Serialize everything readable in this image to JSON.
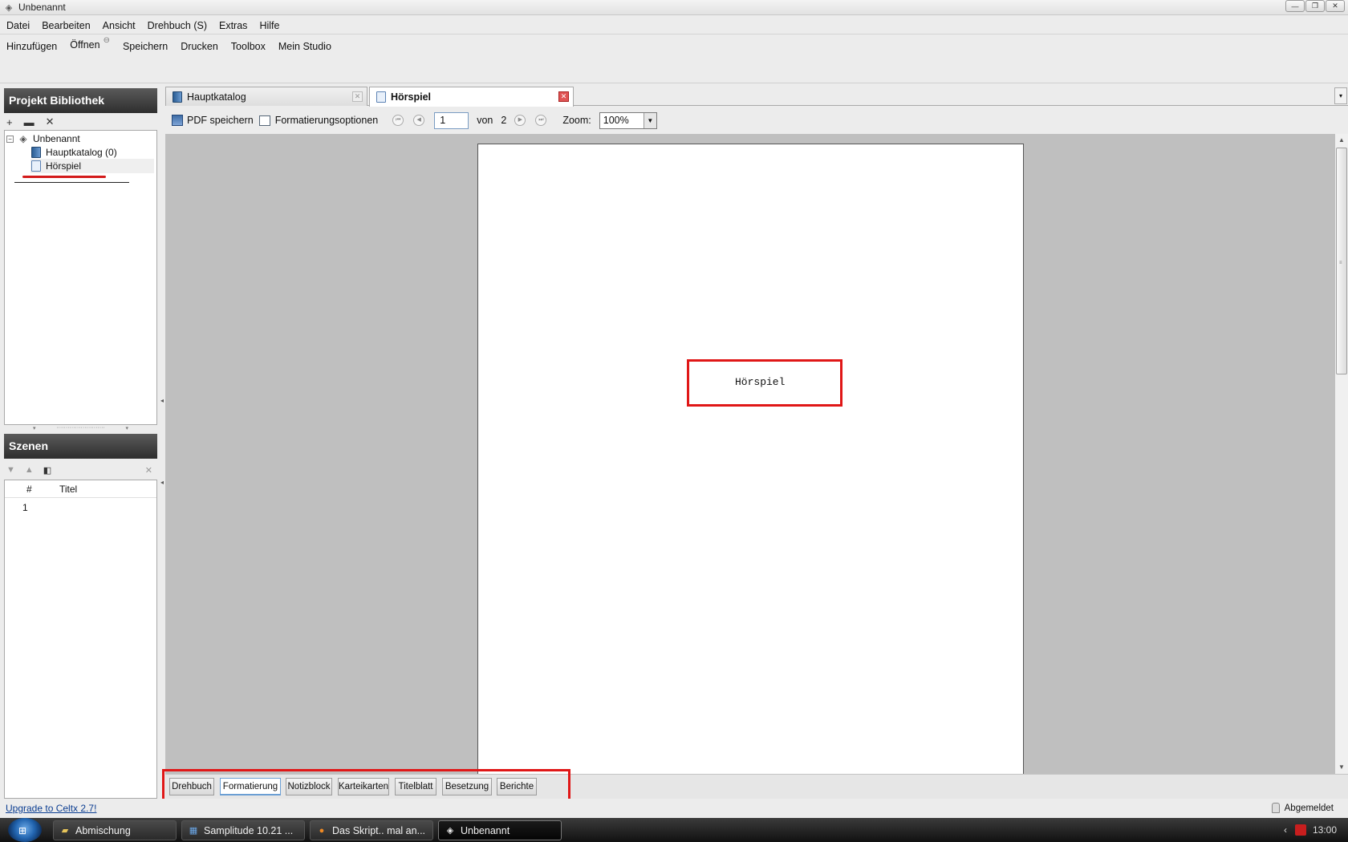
{
  "window": {
    "title": "Unbenannt"
  },
  "menubar": [
    {
      "label": "Datei"
    },
    {
      "label": "Bearbeiten"
    },
    {
      "label": "Ansicht"
    },
    {
      "label": "Drehbuch (S)"
    },
    {
      "label": "Extras"
    },
    {
      "label": "Hilfe"
    }
  ],
  "toolbar": {
    "add": "Hinzufügen",
    "open": "Öffnen",
    "save": "Speichern",
    "print": "Drucken",
    "toolbox": "Toolbox",
    "studio": "Mein Studio"
  },
  "library": {
    "title": "Projekt Bibliothek",
    "tree": {
      "root": "Unbenannt",
      "items": [
        "Hauptkatalog (0)",
        "Hörspiel"
      ]
    }
  },
  "scenes": {
    "title": "Szenen",
    "columns": [
      "#",
      "Titel"
    ],
    "rows": [
      {
        "num": "1",
        "title": ""
      }
    ]
  },
  "editor_tabs": [
    {
      "label": "Hauptkatalog"
    },
    {
      "label": "Hörspiel"
    }
  ],
  "editor_toolbar": {
    "pdf": "PDF speichern",
    "format_options": "Formatierungsoptionen",
    "page_current": "1",
    "of_label": "von",
    "page_total": "2",
    "zoom_label": "Zoom:",
    "zoom_value": "100%"
  },
  "preview": {
    "page_title": "Hörspiel"
  },
  "view_tabs": [
    {
      "label": "Drehbuch"
    },
    {
      "label": "Formatierung"
    },
    {
      "label": "Notizblock"
    },
    {
      "label": "Karteikarten"
    },
    {
      "label": "Titelblatt"
    },
    {
      "label": "Besetzung"
    },
    {
      "label": "Berichte"
    }
  ],
  "status": {
    "upgrade": "Upgrade to Celtx 2.7!",
    "login": "Abgemeldet"
  },
  "taskbar": {
    "items": [
      {
        "label": "Abmischung"
      },
      {
        "label": "Samplitude 10.21 ..."
      },
      {
        "label": "Das Skript.. mal an..."
      },
      {
        "label": "Unbenannt"
      }
    ],
    "clock": "13:00"
  }
}
